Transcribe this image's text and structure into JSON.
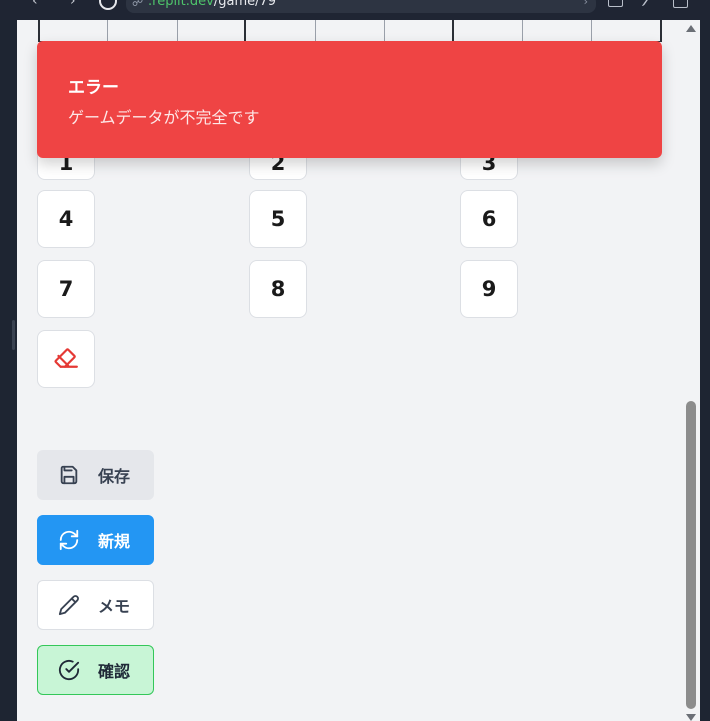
{
  "browser": {
    "url_host": ".replit.dev",
    "url_path": "/game/79"
  },
  "numpad": {
    "keys": [
      "1",
      "2",
      "3",
      "4",
      "5",
      "6",
      "7",
      "8",
      "9"
    ],
    "eraser_icon": "eraser-icon"
  },
  "actions": {
    "save_label": "保存",
    "new_label": "新規",
    "memo_label": "メモ",
    "check_label": "確認"
  },
  "toast": {
    "title": "エラー",
    "message": "ゲームデータが不完全です"
  },
  "colors": {
    "toast_bg": "#ef4444",
    "new_button": "#2396f3",
    "check_button_bg": "#c8f5d6",
    "check_button_border": "#34c759",
    "eraser": "#e53935"
  }
}
